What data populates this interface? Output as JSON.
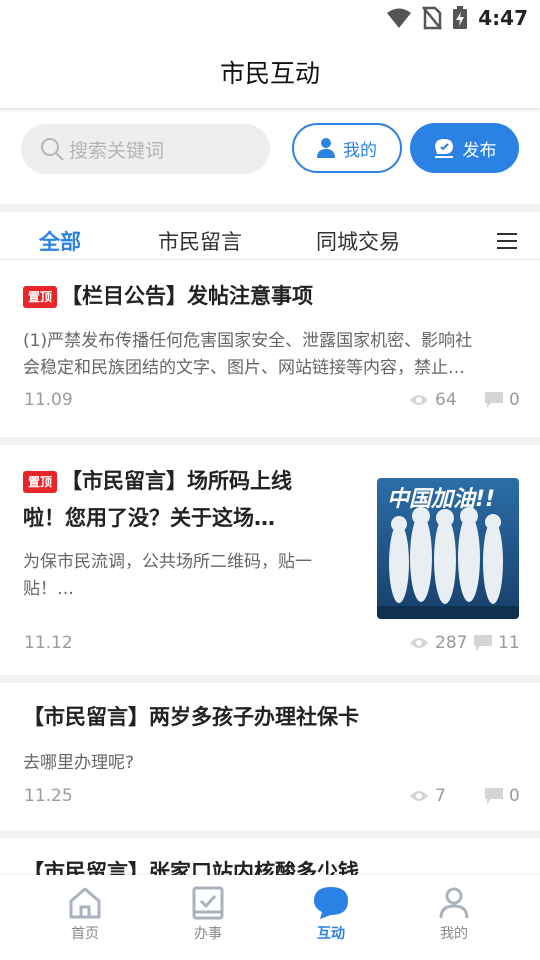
{
  "status_bar": {
    "time": "4:47",
    "icons": [
      "wifi-icon",
      "no-sim-icon",
      "battery-charging-icon"
    ]
  },
  "header": {
    "title": "市民互动"
  },
  "search": {
    "placeholder": "搜索关键词"
  },
  "actions": {
    "mine_label": "我的",
    "post_label": "发布"
  },
  "tabs": [
    {
      "label": "全部",
      "active": true
    },
    {
      "label": "市民留言",
      "active": false
    },
    {
      "label": "同城交易",
      "active": false
    }
  ],
  "posts": [
    {
      "pinned": true,
      "pin_label": "置顶",
      "title": "【栏目公告】发帖注意事项",
      "excerpt_line1": "(1)严禁发布传播任何危害国家安全、泄露国家机密、影响社",
      "excerpt_line2": "会稳定和民族团结的文字、图片、网站链接等内容，禁止…",
      "date": "11.09",
      "views": "64",
      "comments": "0"
    },
    {
      "pinned": true,
      "pin_label": "置顶",
      "title_line1": "【市民留言】场所码上线",
      "title_line2": "啦！您用了没？关于这场…",
      "excerpt_line1": "为保市民流调，公共场所二维码，贴一",
      "excerpt_line2": "贴！…",
      "thumbnail_text": "中国加油!!",
      "date": "11.12",
      "views": "287",
      "comments": "11"
    },
    {
      "pinned": false,
      "title": "【市民留言】两岁多孩子办理社保卡",
      "excerpt_line1": "去哪里办理呢?",
      "date": "11.25",
      "views": "7",
      "comments": "0"
    },
    {
      "pinned": false,
      "title": "【市民留言】张家口站内核酸多少钱"
    }
  ],
  "bottom_nav": [
    {
      "label": "首页",
      "icon": "home-icon",
      "active": false
    },
    {
      "label": "办事",
      "icon": "service-icon",
      "active": false
    },
    {
      "label": "互动",
      "icon": "chat-bubble-icon",
      "active": true
    },
    {
      "label": "我的",
      "icon": "user-icon",
      "active": false
    }
  ],
  "colors": {
    "accent": "#2a82e4",
    "pin": "#e8262a",
    "muted": "#9a9a9a"
  }
}
